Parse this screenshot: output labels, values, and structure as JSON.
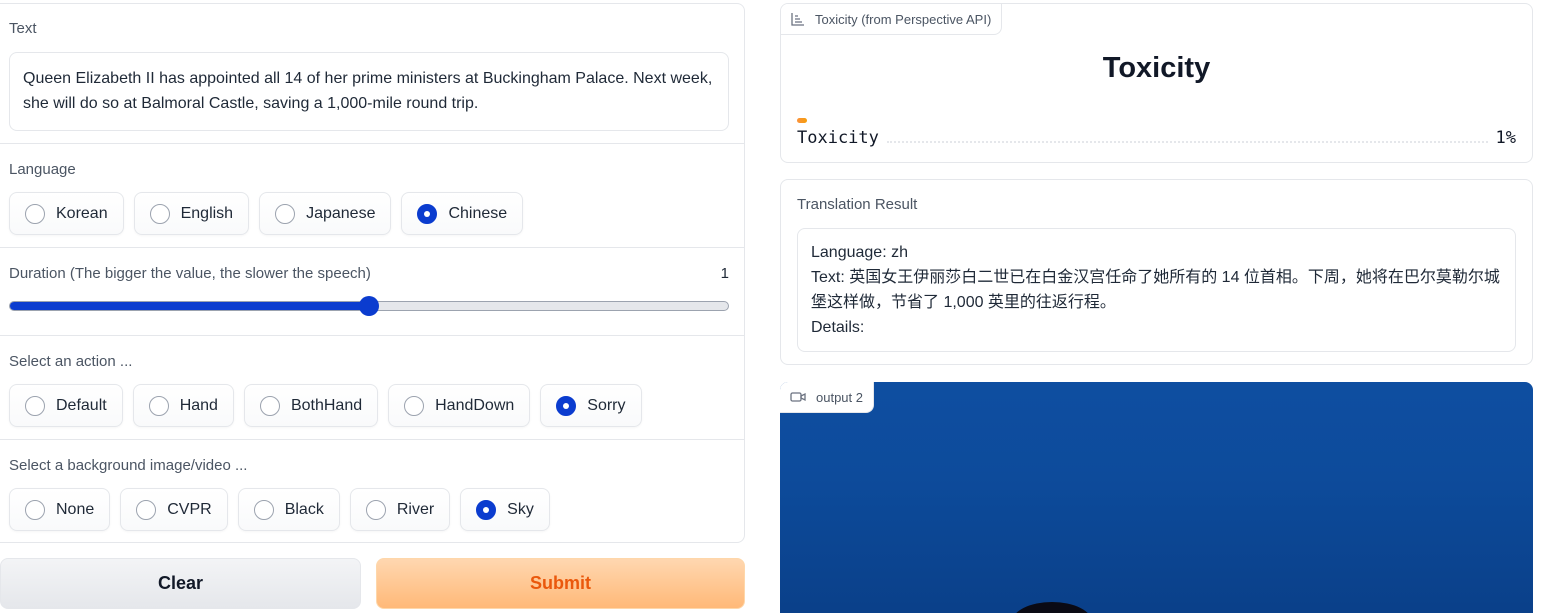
{
  "form": {
    "text": {
      "label": "Text",
      "value": "Queen Elizabeth II has appointed all 14 of her prime ministers at Buckingham Palace. Next week, she will do so at Balmoral Castle, saving a 1,000-mile round trip."
    },
    "language": {
      "label": "Language",
      "options": [
        "Korean",
        "English",
        "Japanese",
        "Chinese"
      ],
      "selected": "Chinese"
    },
    "duration": {
      "label": "Duration (The bigger the value, the slower the speech)",
      "value": "1",
      "fill_fraction": 0.5
    },
    "action": {
      "label": "Select an action ...",
      "options": [
        "Default",
        "Hand",
        "BothHand",
        "HandDown",
        "Sorry"
      ],
      "selected": "Sorry"
    },
    "background": {
      "label": "Select a background image/video ...",
      "options": [
        "None",
        "CVPR",
        "Black",
        "River",
        "Sky"
      ],
      "selected": "Sky"
    },
    "buttons": {
      "clear": "Clear",
      "submit": "Submit"
    }
  },
  "toxicity": {
    "tag": "Toxicity (from Perspective API)",
    "title": "Toxicity",
    "item_label": "Toxicity",
    "item_value": "1%",
    "fraction": 0.01
  },
  "translation": {
    "label": "Translation Result",
    "language_line": "Language: zh",
    "text_line": "Text: 英国女王伊丽莎白二世已在白金汉宫任命了她所有的 14 位首相。下周，她将在巴尔莫勒尔城堡这样做，节省了 1,000 英里的往返行程。",
    "details_line": "Details:"
  },
  "video": {
    "tag": "output 2",
    "icon": "video-camera-icon"
  },
  "colors": {
    "accent": "#0b3ccf",
    "submit_text": "#ea580c",
    "sky": "#0e4ea1"
  }
}
